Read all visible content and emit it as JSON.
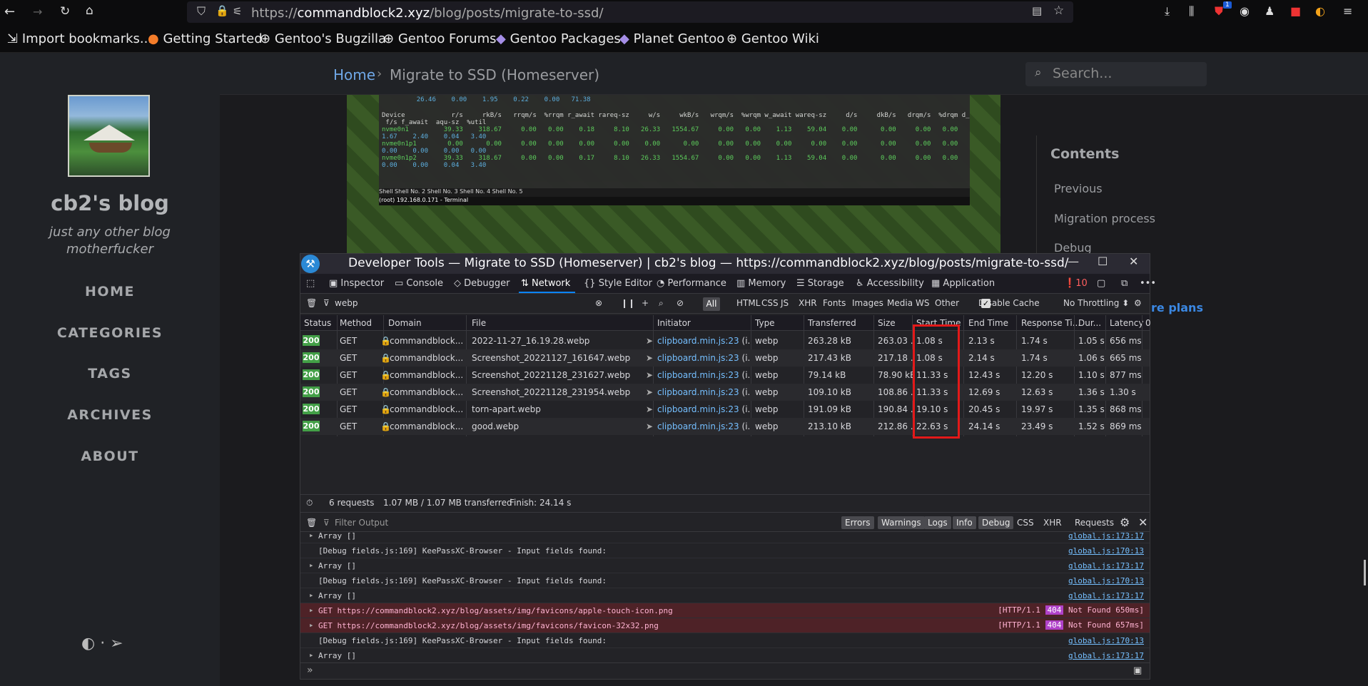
{
  "browser": {
    "url_host": "commandblock2.xyz",
    "url_scheme": "https://",
    "url_path": "/blog/posts/migrate-to-ssd/",
    "bookmarks": [
      "Import bookmarks...",
      "Getting Started",
      "Gentoo's Bugzilla",
      "Gentoo Forums",
      "Gentoo Packages",
      "Planet Gentoo",
      "Gentoo Wiki"
    ],
    "ext_badge": "1"
  },
  "site": {
    "title": "cb2's blog",
    "subtitle": "just any other blog motherfucker",
    "nav": [
      "HOME",
      "CATEGORIES",
      "TAGS",
      "ARCHIVES",
      "ABOUT"
    ],
    "breadcrumb_home": "Home",
    "breadcrumb_sep": "›",
    "breadcrumb_current": "Migrate to SSD (Homeserver)",
    "search_placeholder": "Search...",
    "contents_title": "Contents",
    "toc": [
      "Previous",
      "Migration process",
      "Debug"
    ],
    "more_plans": "re plans"
  },
  "terminal": {
    "lines": [
      "         26.46    0.00    1.95    0.22    0.00   71.38",
      "",
      "Device            r/s     rkB/s   rrqm/s  %rrqm r_await rareq-sz     w/s     wkB/s   wrqm/s  %wrqm w_await wareq-sz     d/s     dkB/s   drqm/s  %drqm d_await dareq-sz",
      " f/s f_await  aqu-sz  %util",
      "nvme0n1         39.33    318.67     0.00   0.00    0.18     8.10   26.33   1554.67     0.00   0.00    1.13    59.04    0.00      0.00     0.00   0.00    0.00     0.00",
      "1.67    2.40    0.04   3.40",
      "nvme0n1p1        0.00      0.00     0.00   0.00    0.00     0.00    0.00      0.00     0.00   0.00    0.00     0.00    0.00      0.00     0.00   0.00    0.00     0.00",
      "0.00    0.00    0.00   0.00",
      "nvme0n1p2       39.33    318.67     0.00   0.00    0.17     8.10   26.33   1554.67     0.00   0.00    1.13    59.04    0.00      0.00     0.00   0.00    0.00     0.00",
      "0.00    0.00    0.04   3.40"
    ],
    "tabs": "Shell  Shell No. 2  Shell No. 3  Shell No. 4  Shell No. 5",
    "status": "(root) 192.168.0.171 - Terminal"
  },
  "devtools": {
    "title": "Developer Tools — Migrate to SSD (Homeserver) | cb2's blog — https://commandblock2.xyz/blog/posts/migrate-to-ssd/",
    "tabs": [
      "Inspector",
      "Console",
      "Debugger",
      "Network",
      "Style Editor",
      "Performance",
      "Memory",
      "Storage",
      "Accessibility",
      "Application"
    ],
    "error_count": "10",
    "filter_value": "webp",
    "type_filters": [
      "All",
      "HTML",
      "CSS",
      "JS",
      "XHR",
      "Fonts",
      "Images",
      "Media",
      "WS",
      "Other"
    ],
    "disable_cache": "Disable Cache",
    "throttling": "No Throttling ⬍",
    "columns": [
      "Status",
      "Method",
      "Domain",
      "File",
      "Initiator",
      "Type",
      "Transferred",
      "Size",
      "Start Time",
      "End Time",
      "Response Ti...",
      "Dur...",
      "Latency",
      "0"
    ],
    "requests": [
      {
        "status": "200",
        "method": "GET",
        "domain": "commandblock...",
        "file": "2022-11-27_16.19.28.webp",
        "initiator": "clipboard.min.js:23",
        "init_suffix": "(i...",
        "type": "webp",
        "transferred": "263.28 kB",
        "size": "263.03 ...",
        "start": "1.08 s",
        "end": "2.13 s",
        "response": "1.74 s",
        "duration": "1.05 s",
        "latency": "656 ms"
      },
      {
        "status": "200",
        "method": "GET",
        "domain": "commandblock...",
        "file": "Screenshot_20221127_161647.webp",
        "initiator": "clipboard.min.js:23",
        "init_suffix": "(i...",
        "type": "webp",
        "transferred": "217.43 kB",
        "size": "217.18 ...",
        "start": "1.08 s",
        "end": "2.14 s",
        "response": "1.74 s",
        "duration": "1.06 s",
        "latency": "665 ms"
      },
      {
        "status": "200",
        "method": "GET",
        "domain": "commandblock...",
        "file": "Screenshot_20221128_231627.webp",
        "initiator": "clipboard.min.js:23",
        "init_suffix": "(i...",
        "type": "webp",
        "transferred": "79.14 kB",
        "size": "78.90 kB",
        "start": "11.33 s",
        "end": "12.43 s",
        "response": "12.20 s",
        "duration": "1.10 s",
        "latency": "877 ms"
      },
      {
        "status": "200",
        "method": "GET",
        "domain": "commandblock...",
        "file": "Screenshot_20221128_231954.webp",
        "initiator": "clipboard.min.js:23",
        "init_suffix": "(i...",
        "type": "webp",
        "transferred": "109.10 kB",
        "size": "108.86 ...",
        "start": "11.33 s",
        "end": "12.69 s",
        "response": "12.63 s",
        "duration": "1.36 s",
        "latency": "1.30 s"
      },
      {
        "status": "200",
        "method": "GET",
        "domain": "commandblock...",
        "file": "torn-apart.webp",
        "initiator": "clipboard.min.js:23",
        "init_suffix": "(i...",
        "type": "webp",
        "transferred": "191.09 kB",
        "size": "190.84 ...",
        "start": "19.10 s",
        "end": "20.45 s",
        "response": "19.97 s",
        "duration": "1.35 s",
        "latency": "868 ms"
      },
      {
        "status": "200",
        "method": "GET",
        "domain": "commandblock...",
        "file": "good.webp",
        "initiator": "clipboard.min.js:23",
        "init_suffix": "(i...",
        "type": "webp",
        "transferred": "213.10 kB",
        "size": "212.86 ...",
        "start": "22.63 s",
        "end": "24.14 s",
        "response": "23.49 s",
        "duration": "1.52 s",
        "latency": "869 ms"
      }
    ],
    "summary_requests": "6 requests",
    "summary_transferred": "1.07 MB / 1.07 MB transferred",
    "summary_finish": "Finish: 24.14 s",
    "console_filter_placeholder": "Filter Output",
    "console_levels": [
      "Errors",
      "Warnings",
      "Logs",
      "Info",
      "Debug"
    ],
    "console_types": [
      "CSS",
      "XHR",
      "Requests"
    ],
    "console_lines": [
      {
        "kind": "array",
        "msg": "Array []",
        "src": "global.js:173:17"
      },
      {
        "kind": "log",
        "msg": "[Debug fields.js:169] KeePassXC-Browser - Input fields found:",
        "src": "global.js:170:13"
      },
      {
        "kind": "array",
        "msg": "Array []",
        "src": "global.js:173:17"
      },
      {
        "kind": "log",
        "msg": "[Debug fields.js:169] KeePassXC-Browser - Input fields found:",
        "src": "global.js:170:13"
      },
      {
        "kind": "array",
        "msg": "Array []",
        "src": "global.js:173:17"
      },
      {
        "kind": "err",
        "msg": "GET https://commandblock2.xyz/blog/assets/img/favicons/apple-touch-icon.png",
        "proto": "[HTTP/1.1",
        "code": "404",
        "reason": "Not Found 650ms]"
      },
      {
        "kind": "err",
        "msg": "GET https://commandblock2.xyz/blog/assets/img/favicons/favicon-32x32.png",
        "proto": "[HTTP/1.1",
        "code": "404",
        "reason": "Not Found 657ms]"
      },
      {
        "kind": "log",
        "msg": "[Debug fields.js:169] KeePassXC-Browser - Input fields found:",
        "src": "global.js:170:13"
      },
      {
        "kind": "array",
        "msg": "Array []",
        "src": "global.js:173:17"
      }
    ],
    "prompt": "»"
  }
}
